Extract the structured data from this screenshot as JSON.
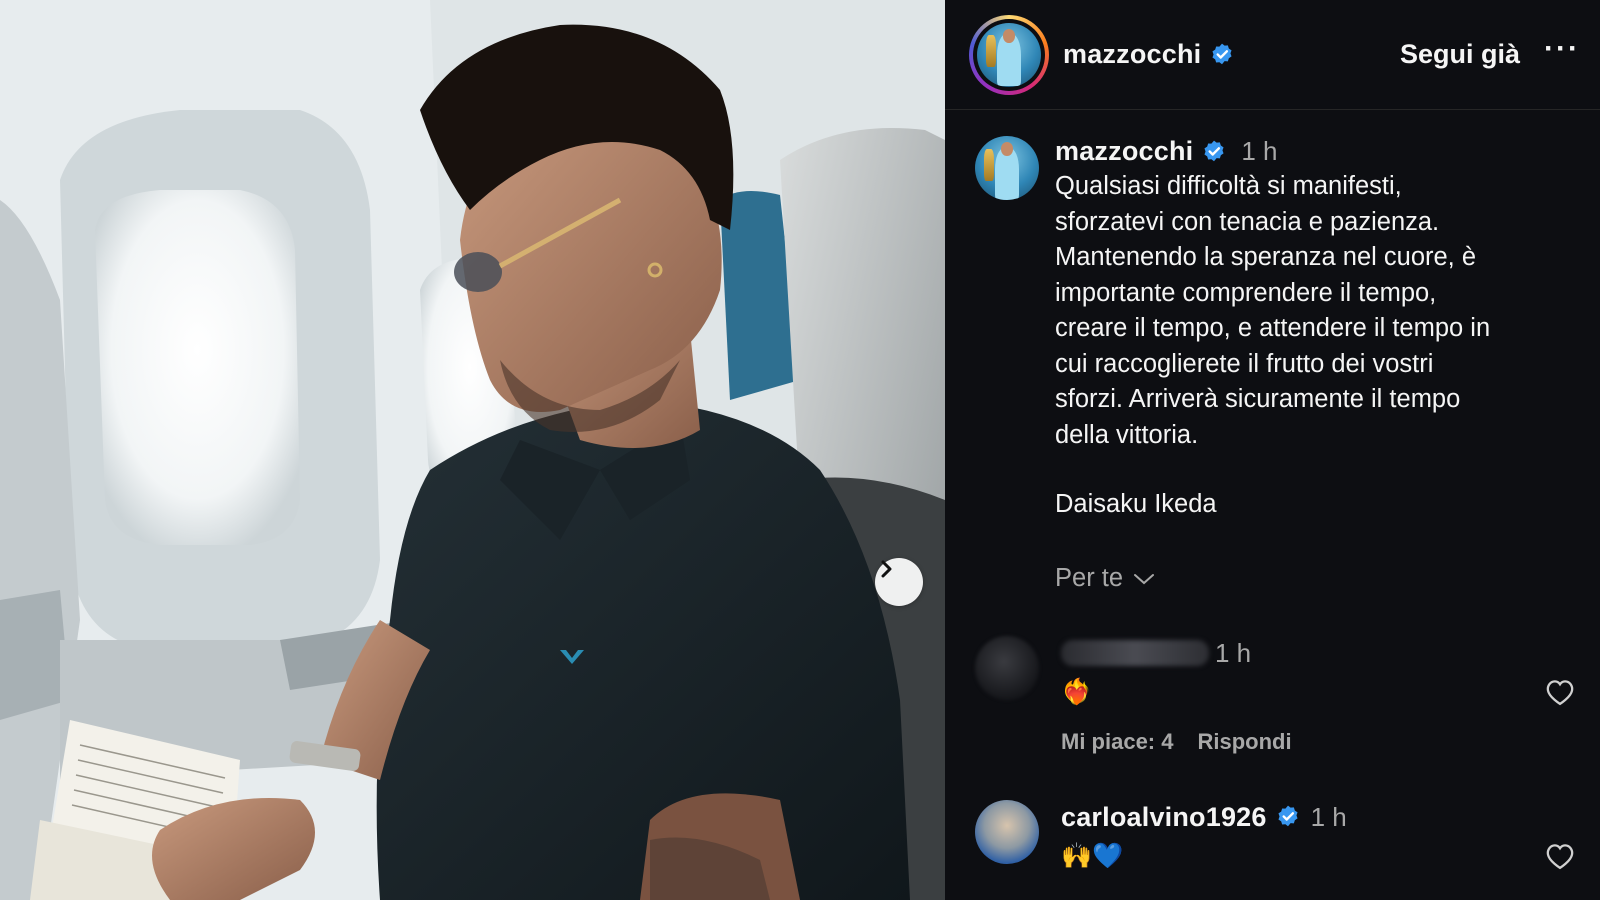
{
  "header": {
    "username": "mazzocchi",
    "follow_label": "Segui già",
    "more_label": "···"
  },
  "caption": {
    "username": "mazzocchi",
    "time": "1 h",
    "text": "Qualsiasi difficoltà si manifesti,\nsforzatevi con tenacia e pazienza.\nMantenendo la speranza nel cuore, è\nimportante comprendere il tempo,\ncreare il tempo, e attendere il tempo in\ncui raccoglierete il frutto dei vostri\nsforzi. Arriverà sicuramente il tempo\ndella vittoria.",
    "author": "Daisaku Ikeda",
    "for_you_label": "Per te"
  },
  "comments": [
    {
      "time": "1 h",
      "emoji": "❤️‍🔥",
      "likes_label": "Mi piace: 4",
      "reply_label": "Rispondi"
    },
    {
      "username": "carloalvino1926",
      "time": "1 h",
      "emoji": "🙌💙"
    }
  ],
  "colors": {
    "panel_bg": "#0d0e12",
    "verified_blue": "#3897f0",
    "muted_text": "#a8a8a8"
  },
  "icons": {
    "verified": "verified-badge-icon",
    "next": "chevron-right-icon",
    "more": "more-dots-icon",
    "heart": "heart-outline-icon",
    "dropdown": "chevron-down-icon"
  }
}
